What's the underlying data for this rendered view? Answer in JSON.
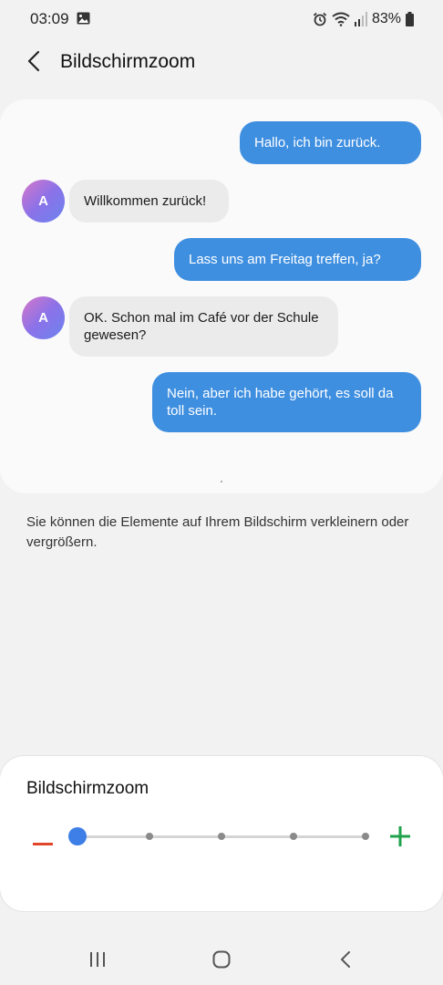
{
  "status_bar": {
    "time": "03:09",
    "battery": "83%",
    "icons": [
      "image-icon",
      "alarm-icon",
      "wifi-icon",
      "signal-icon",
      "battery-icon"
    ]
  },
  "header": {
    "title": "Bildschirmzoom",
    "back_icon": "chevron-left-icon"
  },
  "preview": {
    "messages": [
      {
        "direction": "out",
        "text": "Hallo, ich bin zurück."
      },
      {
        "direction": "in",
        "avatar": "A",
        "text": "Willkommen zurück!"
      },
      {
        "direction": "out",
        "text": "Lass uns am Freitag treffen, ja?"
      },
      {
        "direction": "in",
        "avatar": "A",
        "text": "OK. Schon mal im Café vor der Schule gewesen?"
      },
      {
        "direction": "out",
        "text": "Nein, aber ich habe gehört, es soll da toll sein."
      }
    ]
  },
  "description": "Sie können die Elemente auf Ihrem Bildschirm verkleinern oder vergrößern.",
  "zoom": {
    "title": "Bildschirmzoom",
    "levels": 5,
    "selected_level": 1,
    "minus_color": "#e0472a",
    "plus_color": "#1fa24c",
    "accent": "#3d7fe6"
  },
  "nav_bar": {
    "icons": [
      "recent-apps-icon",
      "home-icon",
      "back-icon"
    ]
  },
  "colors": {
    "outgoing_bubble": "#3f8fe0",
    "incoming_bubble": "#ebebeb",
    "background": "#f2f2f2"
  }
}
